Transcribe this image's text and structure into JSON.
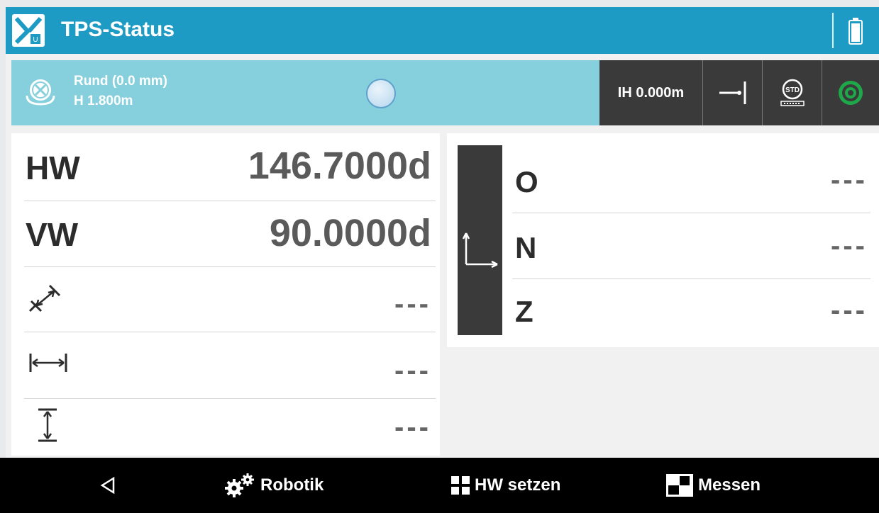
{
  "header": {
    "title": "TPS-Status",
    "logo_icon": "app-logo-icon",
    "battery_icon": "battery-icon"
  },
  "status": {
    "level_line1": "Rund (0.0 mm)",
    "level_line2": "H 1.800m",
    "ih_label": "IH 0.000m",
    "level_icon": "tilt-level-icon",
    "bubble_icon": "bubble-level-icon",
    "ref_icon": "prism-offset-icon",
    "std_icon": "std-mode-icon",
    "target_icon": "target-icon",
    "target_color": "#1ea84a"
  },
  "measurements": {
    "hw_label": "HW",
    "hw_value": "146.7000d",
    "vw_label": "VW",
    "vw_value": "90.0000d",
    "slope_value": "---",
    "horizontal_value": "---",
    "height_value": "---"
  },
  "coordinates": {
    "o_label": "O",
    "o_value": "---",
    "n_label": "N",
    "n_value": "---",
    "z_label": "Z",
    "z_value": "---"
  },
  "nav": {
    "robotik": "Robotik",
    "hw_setzen": "HW setzen",
    "messen": "Messen"
  },
  "colors": {
    "header": "#1e9bc4",
    "statusbar": "#86cfdc",
    "toolbar": "#3a3a3a"
  }
}
